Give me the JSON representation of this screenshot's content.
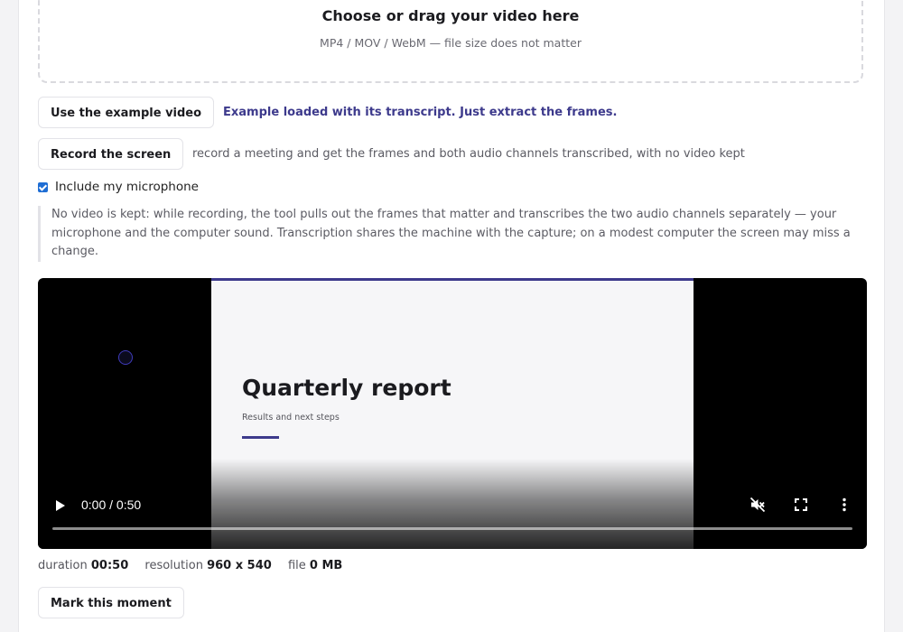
{
  "dropzone": {
    "title": "Choose or drag your video here",
    "subtitle": "MP4 / MOV / WebM — file size does not matter"
  },
  "example": {
    "button_label": "Use the example video",
    "status": "Example loaded with its transcript. Just extract the frames."
  },
  "record": {
    "button_label": "Record the screen",
    "description": "record a meeting and get the frames and both audio channels transcribed, with no video kept"
  },
  "microphone": {
    "label": "Include my microphone",
    "checked": "true"
  },
  "notice": {
    "text": "No video is kept: while recording, the tool pulls out the frames that matter and transcribes the two audio channels separately — your microphone and the computer sound. Transcription shares the machine with the capture; on a modest computer the screen may miss a change."
  },
  "video": {
    "slide_title": "Quarterly report",
    "slide_subtitle": "Results and next steps",
    "timecode": "0:00 / 0:50",
    "progress_fraction": 0,
    "icons": [
      "play-icon",
      "muted-icon",
      "fullscreen-icon",
      "more-options-icon"
    ]
  },
  "meta": {
    "duration_label": "duration",
    "duration_value": "00:50",
    "resolution_label": "resolution",
    "resolution_value": "960 x 540",
    "file_label": "file",
    "file_value": "0 MB"
  },
  "mark": {
    "button_label": "Mark this moment"
  },
  "colors": {
    "accent": "#3d3a8c",
    "checkbox": "#1f6ed4"
  }
}
